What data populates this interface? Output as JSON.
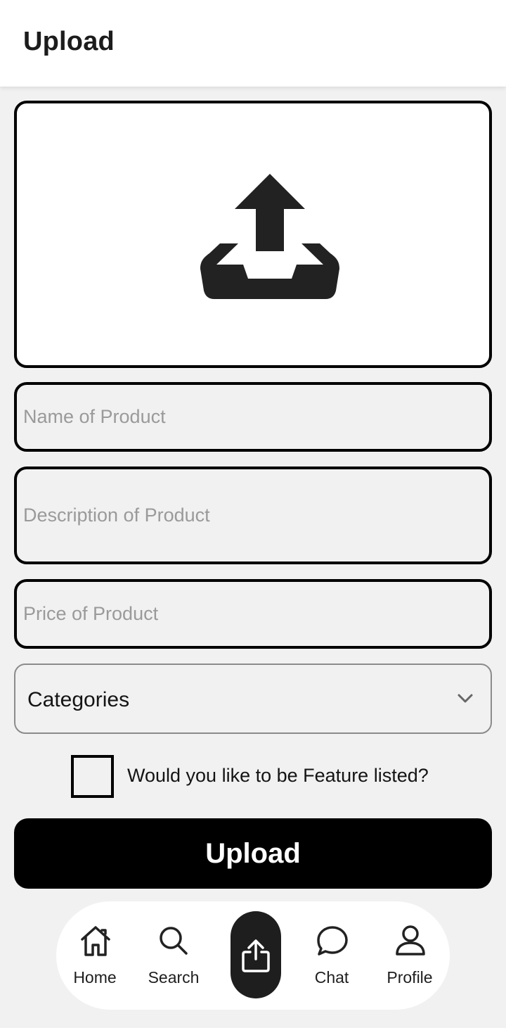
{
  "header": {
    "title": "Upload"
  },
  "upload_area": {
    "icon": "upload-tray-icon"
  },
  "form": {
    "name_placeholder": "Name of Product",
    "description_placeholder": "Description of Product",
    "price_placeholder": "Price of Product",
    "categories_label": "Categories",
    "feature_label": "Would you like to be Feature listed?",
    "feature_checked": false,
    "submit_label": "Upload"
  },
  "nav": {
    "items": [
      {
        "label": "Home",
        "icon": "home-icon"
      },
      {
        "label": "Search",
        "icon": "search-icon"
      },
      {
        "label": "",
        "icon": "share-upload-icon",
        "active": true
      },
      {
        "label": "Chat",
        "icon": "chat-icon"
      },
      {
        "label": "Profile",
        "icon": "profile-icon"
      }
    ]
  },
  "colors": {
    "background": "#f1f1f1",
    "primary": "#000000",
    "nav_active": "#1e1e1e",
    "placeholder": "#9a9a9a"
  }
}
